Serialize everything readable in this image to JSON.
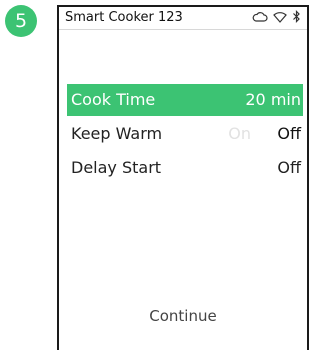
{
  "step": {
    "number": "5"
  },
  "status_bar": {
    "device_name": "Smart Cooker 123",
    "icons": [
      "cloud-icon",
      "wifi-icon",
      "bluetooth-icon"
    ]
  },
  "menu": {
    "cook_time": {
      "label": "Cook Time",
      "value": "20 min",
      "selected": true
    },
    "keep_warm": {
      "label": "Keep Warm",
      "on_label": "On",
      "off_label": "Off",
      "value": "Off"
    },
    "delay_start": {
      "label": "Delay Start",
      "value": "Off"
    }
  },
  "footer": {
    "continue_label": "Continue"
  },
  "colors": {
    "accent": "#3cc373"
  }
}
